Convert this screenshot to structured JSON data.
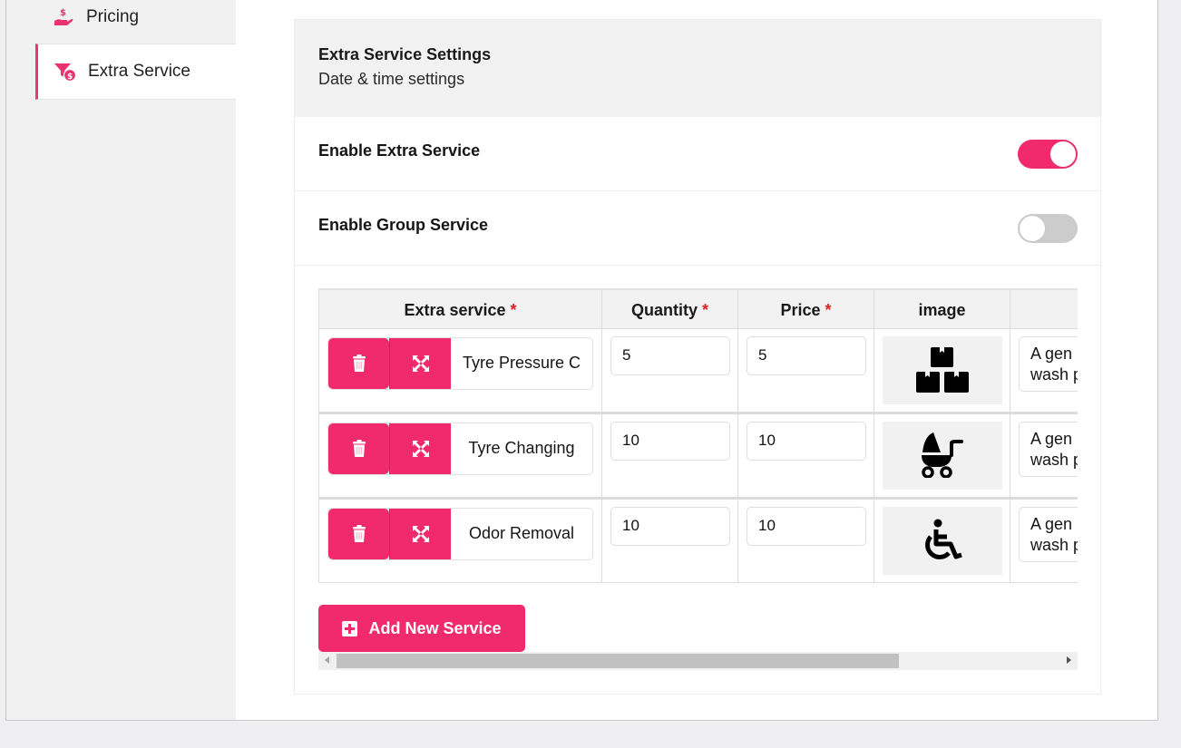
{
  "sidebar": {
    "items": [
      {
        "label": "Pricing",
        "icon": "hand-dollar-icon",
        "active": false
      },
      {
        "label": "Extra Service",
        "icon": "funnel-dollar-icon",
        "active": true
      }
    ]
  },
  "panel": {
    "title": "Extra Service Settings",
    "subtitle": "Date & time settings"
  },
  "settings": [
    {
      "label": "Enable Extra Service",
      "enabled": true
    },
    {
      "label": "Enable Group Service",
      "enabled": false
    }
  ],
  "table": {
    "columns": [
      {
        "label": "Extra service",
        "required": "*"
      },
      {
        "label": "Quantity",
        "required": "*"
      },
      {
        "label": "Price",
        "required": "*"
      },
      {
        "label": "image",
        "required": ""
      },
      {
        "label": "",
        "required": ""
      }
    ],
    "rows": [
      {
        "name": "Tyre Pressure C",
        "quantity": "5",
        "price": "5",
        "image_icon": "boxes-stacked-icon",
        "description": "A gen\nwash p"
      },
      {
        "name": "Tyre Changing",
        "quantity": "10",
        "price": "10",
        "image_icon": "baby-carriage-icon",
        "description": "A gen\nwash p"
      },
      {
        "name": "Odor Removal",
        "quantity": "10",
        "price": "10",
        "image_icon": "wheelchair-icon",
        "description": "A gen\nwash p"
      }
    ]
  },
  "add_button": {
    "label": "Add New Service",
    "icon": "plus-square-icon"
  },
  "colors": {
    "accent": "#f12a6e",
    "toggle_off": "#cccccc",
    "header_bg": "#f2f2f2"
  }
}
